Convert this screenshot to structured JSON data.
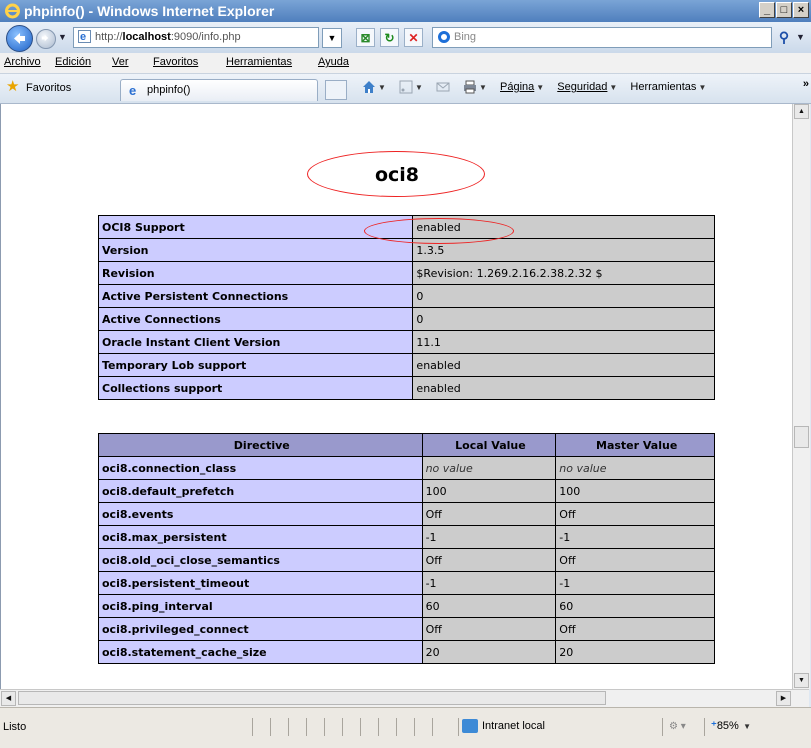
{
  "window": {
    "title": "phpinfo() - Windows Internet Explorer"
  },
  "nav": {
    "address_prefix": "http://",
    "address_host": "localhost",
    "address_rest": ":9090/info.php",
    "search_placeholder": "Bing"
  },
  "menu": [
    "Archivo",
    "Edición",
    "Ver",
    "Favoritos",
    "Herramientas",
    "Ayuda"
  ],
  "favbar": {
    "favorites_label": "Favoritos",
    "tab_label": "phpinfo()",
    "page_label": "Página",
    "security_label": "Seguridad",
    "tools_label": "Herramientas"
  },
  "content": {
    "section_title": "oci8",
    "info_rows": [
      {
        "key": "OCI8 Support",
        "value": "enabled"
      },
      {
        "key": "Version",
        "value": "1.3.5"
      },
      {
        "key": "Revision",
        "value": "$Revision: 1.269.2.16.2.38.2.32 $"
      },
      {
        "key": "Active Persistent Connections",
        "value": "0"
      },
      {
        "key": "Active Connections",
        "value": "0"
      },
      {
        "key": "Oracle Instant Client Version",
        "value": "11.1"
      },
      {
        "key": "Temporary Lob support",
        "value": "enabled"
      },
      {
        "key": "Collections support",
        "value": "enabled"
      }
    ],
    "directive_headers": [
      "Directive",
      "Local Value",
      "Master Value"
    ],
    "directives": [
      {
        "name": "oci8.connection_class",
        "local": "no value",
        "master": "no value"
      },
      {
        "name": "oci8.default_prefetch",
        "local": "100",
        "master": "100"
      },
      {
        "name": "oci8.events",
        "local": "Off",
        "master": "Off"
      },
      {
        "name": "oci8.max_persistent",
        "local": "-1",
        "master": "-1"
      },
      {
        "name": "oci8.old_oci_close_semantics",
        "local": "Off",
        "master": "Off"
      },
      {
        "name": "oci8.persistent_timeout",
        "local": "-1",
        "master": "-1"
      },
      {
        "name": "oci8.ping_interval",
        "local": "60",
        "master": "60"
      },
      {
        "name": "oci8.privileged_connect",
        "local": "Off",
        "master": "Off"
      },
      {
        "name": "oci8.statement_cache_size",
        "local": "20",
        "master": "20"
      }
    ]
  },
  "status": {
    "text": "Listo",
    "zone": "Intranet local",
    "zoom": "85%"
  },
  "colors": {
    "key_cell": "#ccccff",
    "value_cell": "#cccccc",
    "header_cell": "#9999cc",
    "highlight_ellipse": "#ee2222"
  }
}
